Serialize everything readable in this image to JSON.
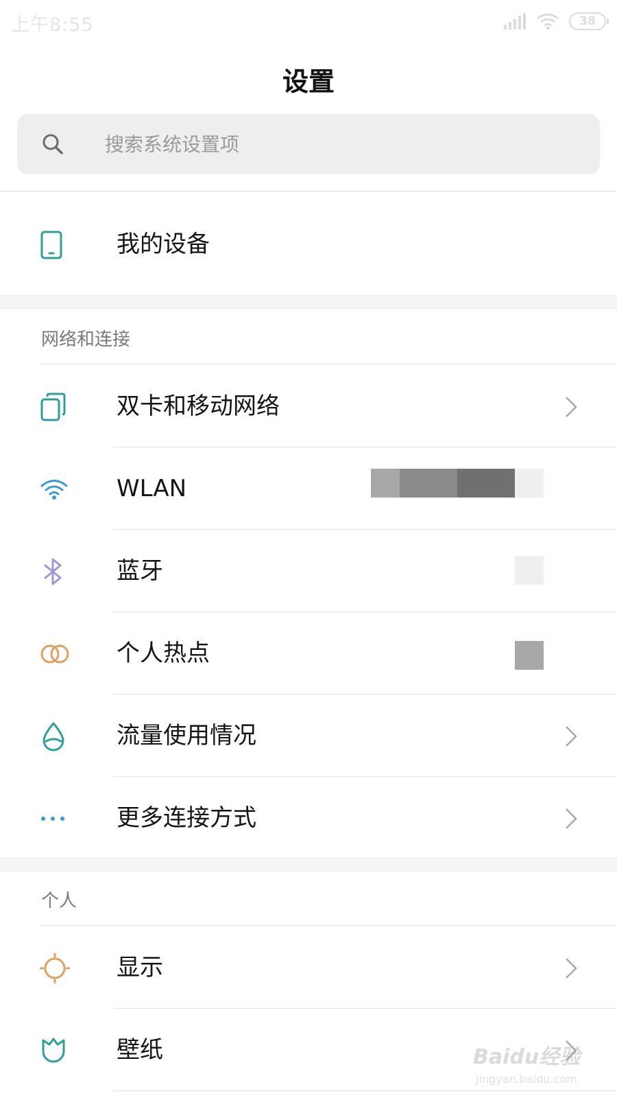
{
  "status_bar": {
    "time": "上午8:55",
    "battery": "38"
  },
  "page_title": "设置",
  "search": {
    "placeholder": "搜索系统设置项"
  },
  "my_device": {
    "label": "我的设备"
  },
  "section_network": {
    "header": "网络和连接",
    "items": [
      {
        "label": "双卡和移动网络",
        "icon": "dual-sim-icon"
      },
      {
        "label": "WLAN",
        "icon": "wifi-icon"
      },
      {
        "label": "蓝牙",
        "icon": "bluetooth-icon"
      },
      {
        "label": "个人热点",
        "icon": "hotspot-icon"
      },
      {
        "label": "流量使用情况",
        "icon": "data-usage-icon"
      },
      {
        "label": "更多连接方式",
        "icon": "more-connections-icon"
      }
    ]
  },
  "section_personal": {
    "header": "个人",
    "items": [
      {
        "label": "显示",
        "icon": "display-icon"
      },
      {
        "label": "壁纸",
        "icon": "wallpaper-icon"
      }
    ]
  },
  "watermark": {
    "brand": "Baidu经验",
    "url": "jingyan.baidu.com"
  },
  "colors": {
    "teal": "#2e9f98",
    "blue": "#3a9bd0",
    "purple": "#a595d9",
    "orange": "#e0a060",
    "accent_text": "#151515"
  }
}
